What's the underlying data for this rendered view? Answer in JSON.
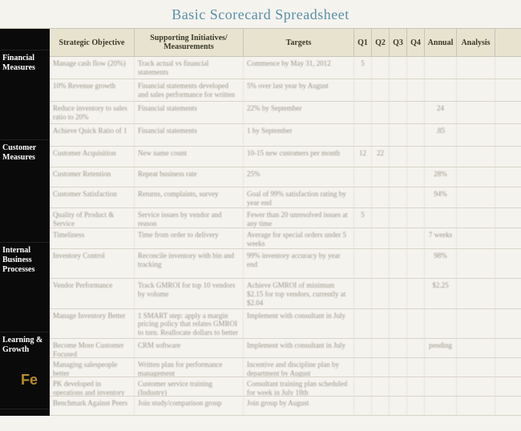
{
  "title": "Basic Scorecard Spreadsheet",
  "watermark": "Fe",
  "columns": {
    "strategic": "Strategic Objective",
    "supporting": "Supporting Initiatives/\nMeasurements",
    "targets": "Targets",
    "q1": "Q1",
    "q2": "Q2",
    "q3": "Q3",
    "q4": "Q4",
    "annual": "Annual",
    "analysis": "Analysis"
  },
  "sections": [
    {
      "label": "Financial Measures",
      "height": 112,
      "rows": [
        {
          "obj": "Manage cash flow (20%)",
          "sup": "Track actual vs financial statements",
          "tgt": "Commence by May 31, 2012",
          "q1": "5",
          "q2": "",
          "q3": "",
          "q4": "",
          "ann": "",
          "ana": ""
        },
        {
          "obj": "10% Revenue growth",
          "sup": "Financial statements developed and sales performance for written business",
          "tgt": "5% over last year by August",
          "q1": "",
          "q2": "",
          "q3": "",
          "q4": "",
          "ann": "",
          "ana": ""
        },
        {
          "obj": "Reduce inventory to sales ratio to 20%",
          "sup": "Financial statements",
          "tgt": "22% by September",
          "q1": "",
          "q2": "",
          "q3": "",
          "q4": "",
          "ann": "24",
          "ana": ""
        },
        {
          "obj": "Achieve Quick Ratio of 1",
          "sup": "Financial statements",
          "tgt": "1 by September",
          "q1": "",
          "q2": "",
          "q3": "",
          "q4": "",
          "ann": ".85",
          "ana": ""
        }
      ]
    },
    {
      "label": "Customer Measures",
      "height": 128,
      "rows": [
        {
          "obj": "Customer Acquisition",
          "sup": "New name count",
          "tgt": "10-15 new customers per month",
          "q1": "12",
          "q2": "22",
          "q3": "",
          "q4": "",
          "ann": "",
          "ana": ""
        },
        {
          "obj": "Customer Retention",
          "sup": "Repeat business rate",
          "tgt": "25%",
          "q1": "",
          "q2": "",
          "q3": "",
          "q4": "",
          "ann": "28%",
          "ana": ""
        },
        {
          "obj": "Customer Satisfaction",
          "sup": "Returns, complaints, survey",
          "tgt": "Goal of 99% satisfaction rating by year end",
          "q1": "",
          "q2": "",
          "q3": "",
          "q4": "",
          "ann": "94%",
          "ana": ""
        },
        {
          "obj": "Quality of Product & Service",
          "sup": "Service issues by vendor and reason",
          "tgt": "Fewer than 20 unresolved issues at any time",
          "q1": "5",
          "q2": "",
          "q3": "",
          "q4": "",
          "ann": "",
          "ana": ""
        },
        {
          "obj": "Timeliness",
          "sup": "Time from order to delivery",
          "tgt": "Average for special orders under 5 weeks",
          "q1": "",
          "q2": "",
          "q3": "",
          "q4": "",
          "ann": "7 weeks",
          "ana": ""
        }
      ]
    },
    {
      "label": "Internal Business Processes",
      "height": 112,
      "rows": [
        {
          "obj": "Inventory Control",
          "sup": "Reconcile inventory with bin and tracking",
          "tgt": "99% inventory accuracy by year end",
          "q1": "",
          "q2": "",
          "q3": "",
          "q4": "",
          "ann": "98%",
          "ana": ""
        },
        {
          "obj": "Vendor Performance",
          "sup": "Track GMROI for top 10 vendors by volume",
          "tgt": "Achieve GMROI of minimum $2.15 for top vendors, currently at $2.04",
          "q1": "",
          "q2": "",
          "q3": "",
          "q4": "",
          "ann": "$2.25",
          "ana": ""
        },
        {
          "obj": "Manage Inventory Better",
          "sup": "1 SMART step: apply a margin pricing policy that relates GMROI to turn. Reallocate dollars to better stocked products",
          "tgt": "Implement with consultant in July",
          "q1": "",
          "q2": "",
          "q3": "",
          "q4": "",
          "ann": "",
          "ana": ""
        }
      ]
    },
    {
      "label": "Learning & Growth",
      "height": 96,
      "rows": [
        {
          "obj": "Become More Customer Focused",
          "sup": "CRM software",
          "tgt": "Implement with consultant in July",
          "q1": "",
          "q2": "",
          "q3": "",
          "q4": "",
          "ann": "pending",
          "ana": ""
        },
        {
          "obj": "Managing salespeople better",
          "sup": "Written plan for performance management",
          "tgt": "Incentive and discipline plan by department by August",
          "q1": "",
          "q2": "",
          "q3": "",
          "q4": "",
          "ann": "",
          "ana": ""
        },
        {
          "obj": "PK developed in operations and inventory management",
          "sup": "Customer service training (Industry)",
          "tgt": "Consultant training plan scheduled for week in July 18th",
          "q1": "",
          "q2": "",
          "q3": "",
          "q4": "",
          "ann": "",
          "ana": ""
        },
        {
          "obj": "Benchmark Against Peers",
          "sup": "Join study/comparison group",
          "tgt": "Join group by August",
          "q1": "",
          "q2": "",
          "q3": "",
          "q4": "",
          "ann": "",
          "ana": ""
        }
      ]
    }
  ]
}
